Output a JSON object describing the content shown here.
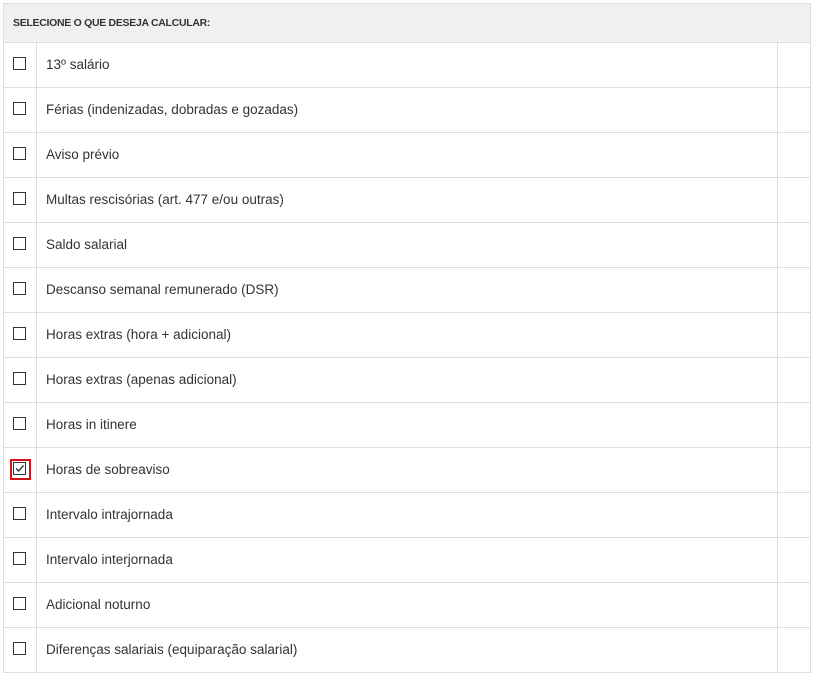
{
  "header": {
    "title": "SELECIONE O QUE DESEJA CALCULAR:"
  },
  "items": [
    {
      "label": "13º salário",
      "checked": false
    },
    {
      "label": "Férias (indenizadas, dobradas e gozadas)",
      "checked": false
    },
    {
      "label": "Aviso prévio",
      "checked": false
    },
    {
      "label": "Multas rescisórias (art. 477 e/ou outras)",
      "checked": false
    },
    {
      "label": "Saldo salarial",
      "checked": false
    },
    {
      "label": "Descanso semanal remunerado (DSR)",
      "checked": false
    },
    {
      "label": "Horas extras (hora + adicional)",
      "checked": false
    },
    {
      "label": "Horas extras (apenas adicional)",
      "checked": false
    },
    {
      "label": "Horas in itinere",
      "checked": false
    },
    {
      "label": "Horas de sobreaviso",
      "checked": true,
      "highlighted": true
    },
    {
      "label": "Intervalo intrajornada",
      "checked": false
    },
    {
      "label": "Intervalo interjornada",
      "checked": false
    },
    {
      "label": "Adicional noturno",
      "checked": false
    },
    {
      "label": "Diferenças salariais (equiparação salarial)",
      "checked": false
    }
  ],
  "colors": {
    "highlight": "#d0141b",
    "border": "#dddddd",
    "header_bg": "#f0f0f0"
  }
}
